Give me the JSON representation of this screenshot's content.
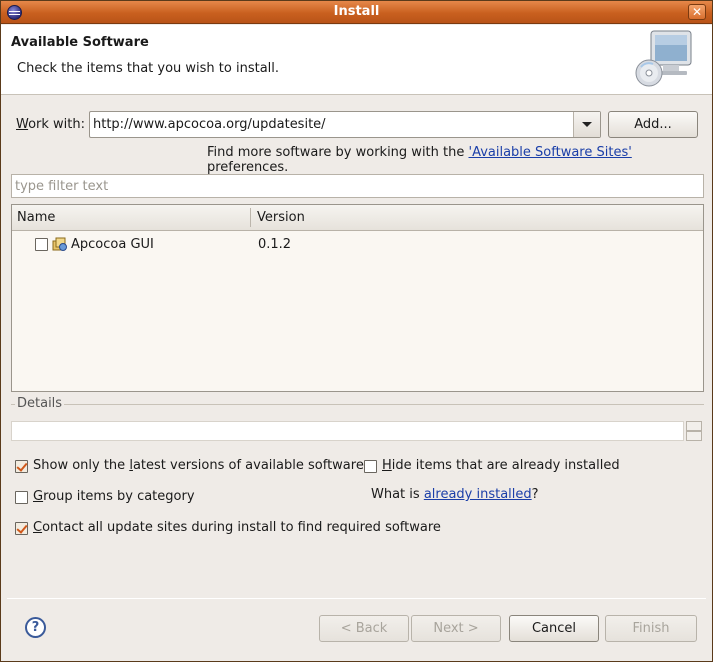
{
  "window": {
    "title": "Install",
    "app_icon": "eclipse-icon",
    "close_label": "✕"
  },
  "header": {
    "title": "Available Software",
    "description": "Check the items that you wish to install.",
    "icon": "monitor-cd-icon"
  },
  "work_with": {
    "label": "Work with:",
    "value": "http://www.apcocoa.org/updatesite/",
    "add_button": "Add..."
  },
  "find_more": {
    "prefix": "Find more software by working with the ",
    "link": "'Available Software Sites'",
    "suffix": " preferences."
  },
  "filter": {
    "placeholder": "type filter text"
  },
  "table": {
    "columns": [
      "Name",
      "Version"
    ],
    "rows": [
      {
        "name": "Apcocoa GUI",
        "version": "0.1.2",
        "checked": false,
        "icon": "feature-package-icon"
      }
    ]
  },
  "details": {
    "label": "Details"
  },
  "options": {
    "show_latest": {
      "label": "Show only the latest versions of available software",
      "checked": true
    },
    "hide_installed": {
      "label": "Hide items that are already installed",
      "checked": false
    },
    "group_category": {
      "label": "Group items by category",
      "checked": false
    },
    "what_is_prefix": "What is ",
    "what_is_link": "already installed",
    "what_is_suffix": "?",
    "contact_sites": {
      "label": "Contact all update sites during install to find required software",
      "checked": true
    }
  },
  "footer": {
    "help_icon": "help-icon",
    "back": "< Back",
    "next": "Next >",
    "cancel": "Cancel",
    "finish": "Finish"
  },
  "colors": {
    "titlebar": "#c9601f",
    "check": "#d0581a",
    "link": "#1a3ea8"
  }
}
